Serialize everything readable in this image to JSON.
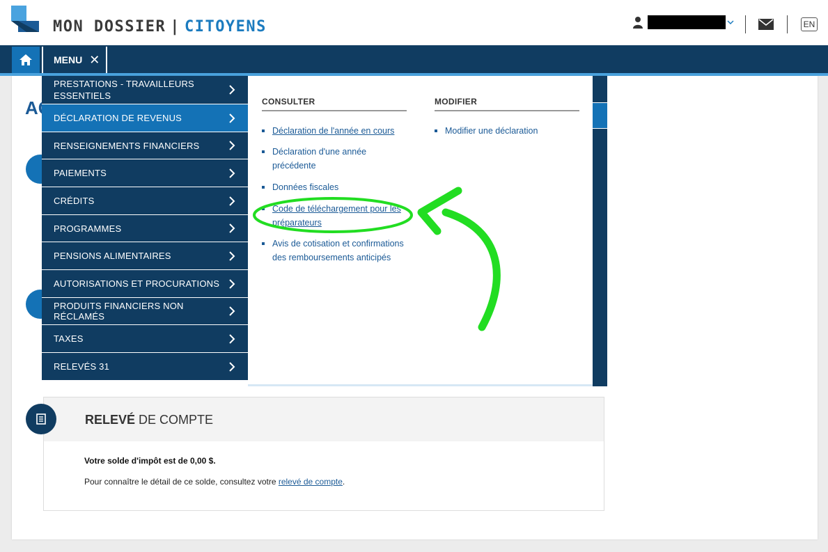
{
  "header": {
    "brand_left": "MON DOSSIER",
    "brand_sep": "|",
    "brand_right": "CITOYENS",
    "lang_label": "EN"
  },
  "nav": {
    "menu_label": "MENU",
    "close_glyph": "✕"
  },
  "partial_title": "AC",
  "menu": {
    "items": [
      {
        "label": "PRESTATIONS - TRAVAILLEURS ESSENTIELS"
      },
      {
        "label": "DÉCLARATION DE REVENUS"
      },
      {
        "label": "RENSEIGNEMENTS FINANCIERS"
      },
      {
        "label": "PAIEMENTS"
      },
      {
        "label": "CRÉDITS"
      },
      {
        "label": "PROGRAMMES"
      },
      {
        "label": "PENSIONS ALIMENTAIRES"
      },
      {
        "label": "AUTORISATIONS ET PROCURATIONS"
      },
      {
        "label": "PRODUITS FINANCIERS NON RÉCLAMÉS"
      },
      {
        "label": "TAXES"
      },
      {
        "label": "RELEVÉS 31"
      }
    ]
  },
  "submenu": {
    "consulter": {
      "heading": "CONSULTER",
      "links": [
        {
          "label": "Déclaration de l'année en cours"
        },
        {
          "label": "Déclaration d'une année précédente"
        },
        {
          "label": "Données fiscales"
        },
        {
          "label": "Code de téléchargement pour les préparateurs"
        },
        {
          "label": "Avis de cotisation et confirmations des remboursements anticipés"
        }
      ]
    },
    "modifier": {
      "heading": "MODIFIER",
      "links": [
        {
          "label": "Modifier une déclaration"
        }
      ]
    }
  },
  "statement": {
    "title_strong": "RELEVÉ",
    "title_rest": " DE COMPTE",
    "balance_text": "Votre solde d'impôt est de 0,00 $.",
    "detail_prefix": "Pour connaître le détail de ce solde, consultez votre ",
    "detail_link": "relevé de compte",
    "detail_suffix": "."
  },
  "colors": {
    "navy": "#103c61",
    "blue": "#1472b6",
    "accent": "#4aa3df",
    "annotation_green": "#22dd22"
  },
  "icons": {
    "home": "home-icon",
    "user": "user-icon",
    "mail": "mail-icon",
    "chevron": "chevron-right-icon",
    "document": "document-icon"
  }
}
